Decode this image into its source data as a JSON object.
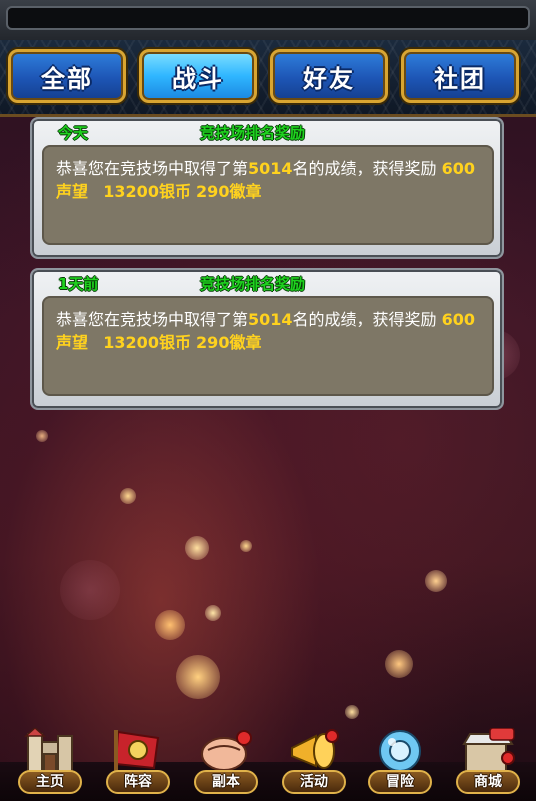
{
  "tabs": [
    {
      "label": "全部",
      "active": false
    },
    {
      "label": "战斗",
      "active": true
    },
    {
      "label": "好友",
      "active": false
    },
    {
      "label": "社团",
      "active": false
    }
  ],
  "messages": [
    {
      "time": "今天",
      "title": "竞技场排名奖励",
      "text_prefix": "恭喜您在竞技场中取得了第",
      "rank": "5014",
      "text_suffix": "名的成绩，获得奖励",
      "reward_reputation": "600声望",
      "reward_silver": "13200银币",
      "reward_badge": "290徽章"
    },
    {
      "time": "1天前",
      "title": "竞技场排名奖励",
      "text_prefix": "恭喜您在竞技场中取得了第",
      "rank": "5014",
      "text_suffix": "名的成绩，获得奖励",
      "reward_reputation": "600声望",
      "reward_silver": "13200银币",
      "reward_badge": "290徽章"
    }
  ],
  "nav": [
    {
      "label": "主页",
      "icon": "castle-icon"
    },
    {
      "label": "阵容",
      "icon": "flag-icon"
    },
    {
      "label": "副本",
      "icon": "fist-icon"
    },
    {
      "label": "活动",
      "icon": "horn-icon"
    },
    {
      "label": "冒险",
      "icon": "orb-icon"
    },
    {
      "label": "商城",
      "icon": "shop-icon"
    }
  ],
  "colors": {
    "highlight": "#ffd21e",
    "title_green": "#1fd21f",
    "tab_border": "#d9a531"
  }
}
